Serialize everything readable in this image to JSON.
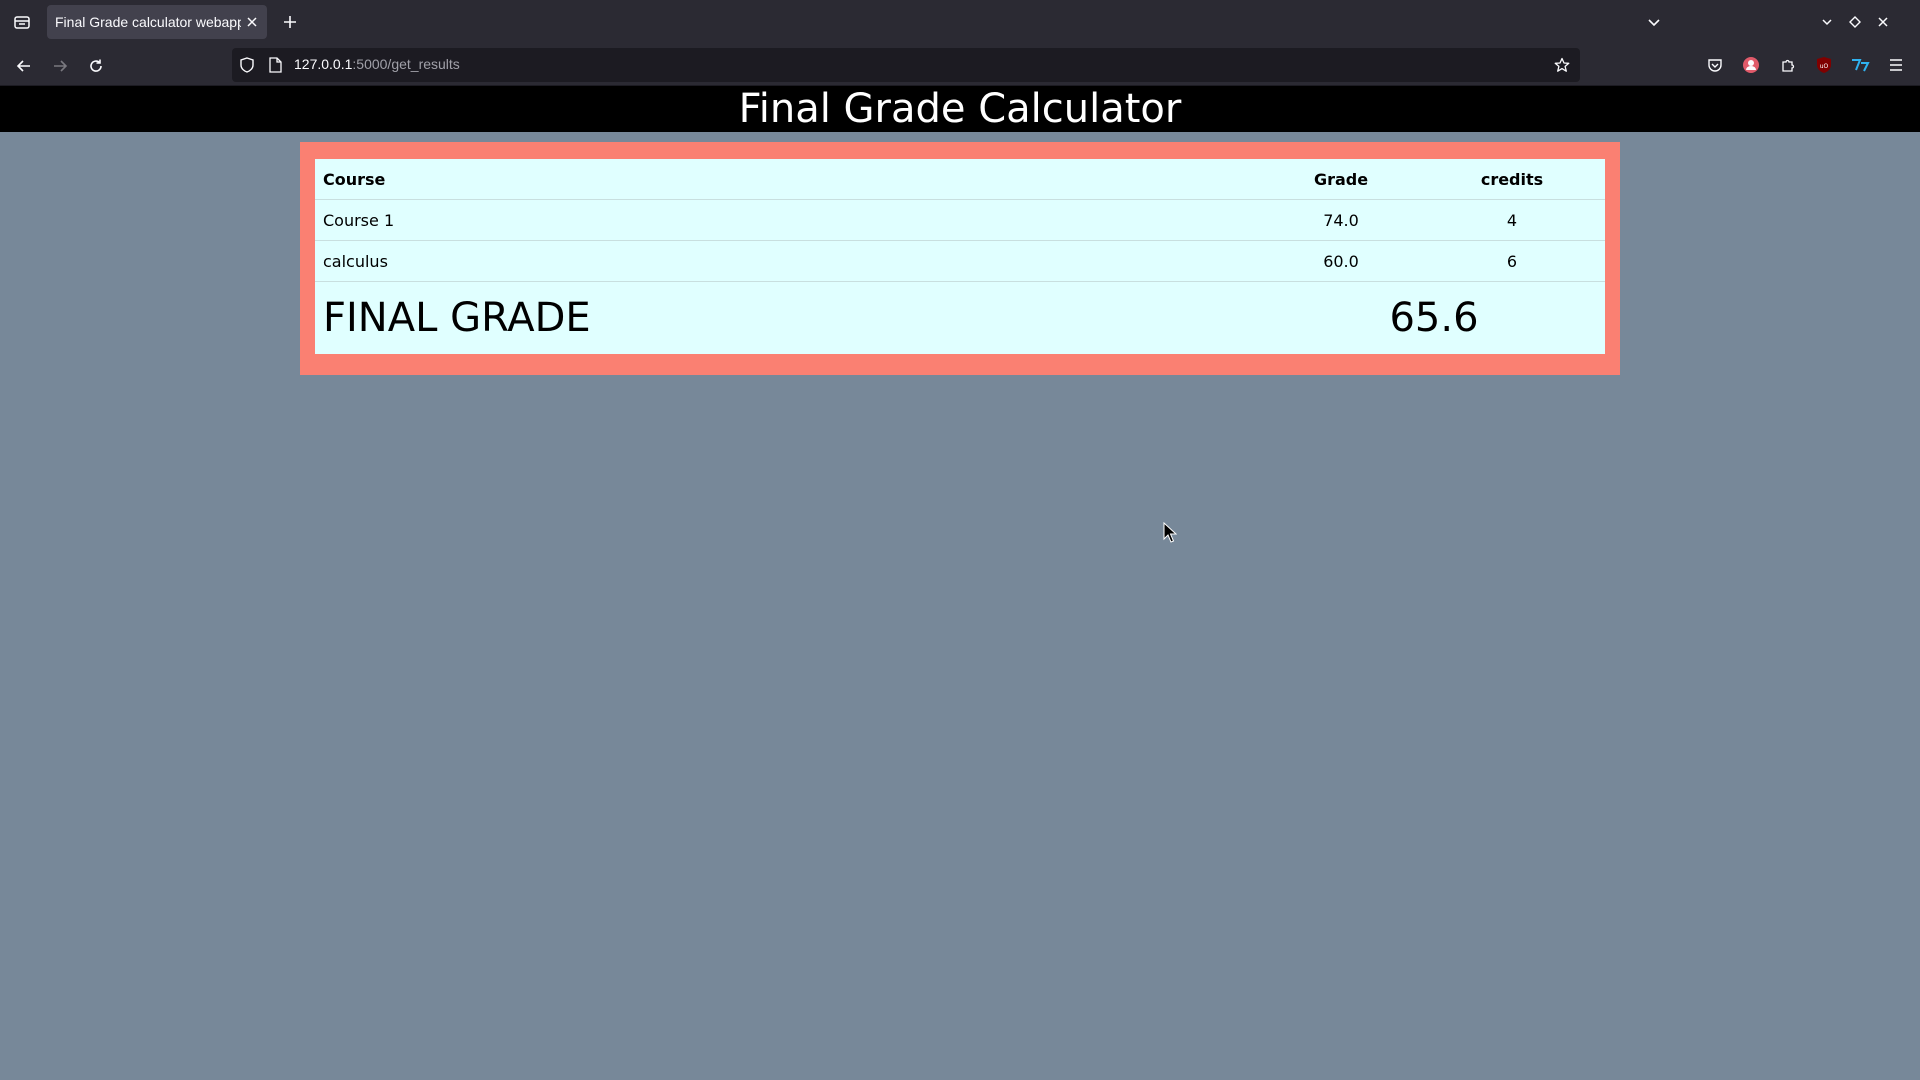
{
  "browser": {
    "tab_title": "Final Grade calculator webapp",
    "url_host": "127.0.0.1",
    "url_path": ":5000/get_results"
  },
  "page": {
    "title": "Final Grade Calculator"
  },
  "table": {
    "headers": {
      "course": "Course",
      "grade": "Grade",
      "credits": "credits"
    },
    "rows": [
      {
        "course": "Course 1",
        "grade": "74.0",
        "credits": "4"
      },
      {
        "course": "calculus",
        "grade": "60.0",
        "credits": "6"
      }
    ],
    "final_label": "FINAL GRADE",
    "final_value": "65.6"
  },
  "colors": {
    "page_background": "#778899",
    "header_background": "#000000",
    "frame_background": "#fa8072",
    "table_background": "#e0ffff"
  },
  "icons": {
    "tab_list": "tab-overview-icon",
    "new_tab": "plus-icon",
    "back": "arrow-left-icon",
    "forward": "arrow-right-icon",
    "reload": "reload-icon",
    "bookmark": "star-icon"
  }
}
